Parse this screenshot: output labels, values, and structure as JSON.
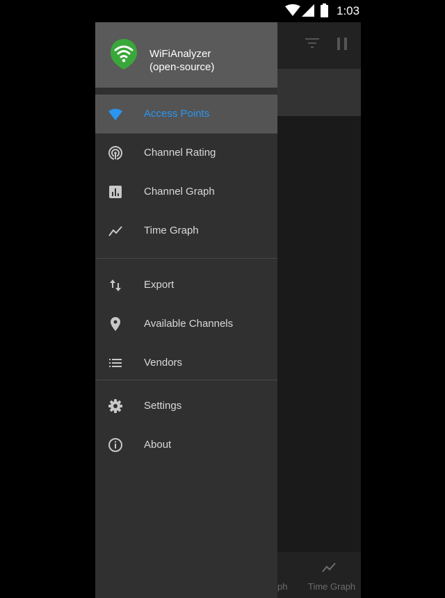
{
  "status_bar": {
    "time": "1:03"
  },
  "app": {
    "bottom_nav": {
      "partial_label": "ph",
      "time_graph_label": "Time Graph"
    }
  },
  "drawer": {
    "header": {
      "app_name_line1": "WiFiAnalyzer",
      "app_name_line2": "(open-source)"
    },
    "items": [
      {
        "label": "Access Points",
        "icon": "wifi-icon"
      },
      {
        "label": "Channel Rating",
        "icon": "signal-rating-icon"
      },
      {
        "label": "Channel Graph",
        "icon": "bar-graph-icon"
      },
      {
        "label": "Time Graph",
        "icon": "line-graph-icon"
      },
      {
        "label": "Export",
        "icon": "import-export-icon"
      },
      {
        "label": "Available Channels",
        "icon": "location-pin-icon"
      },
      {
        "label": "Vendors",
        "icon": "list-icon"
      },
      {
        "label": "Settings",
        "icon": "gear-icon"
      },
      {
        "label": "About",
        "icon": "info-icon"
      }
    ],
    "active_index": 0
  },
  "colors": {
    "accent": "#2b96f0",
    "logo_green": "#3aa73a",
    "drawer_bg": "#303030",
    "header_bg": "#5a5a5a"
  }
}
